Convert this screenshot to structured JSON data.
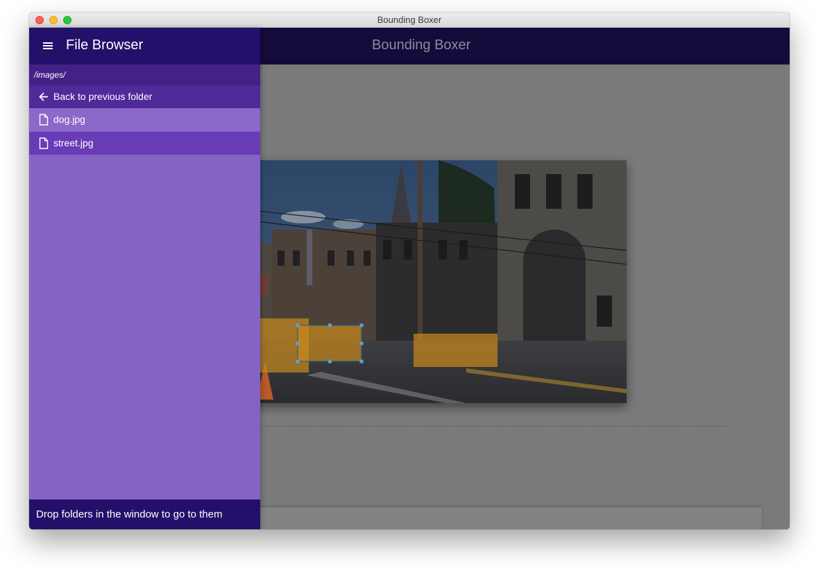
{
  "window": {
    "title": "Bounding Boxer"
  },
  "app_bar": {
    "title": "Bounding Boxer"
  },
  "drawer": {
    "title": "File Browser",
    "menu_icon": "hamburger-menu-icon",
    "current_path": "/images/",
    "back_item": {
      "label": "Back to previous folder",
      "icon": "arrow-left-icon"
    },
    "files": [
      {
        "label": "dog.jpg",
        "icon": "file-icon"
      },
      {
        "label": "street.jpg",
        "icon": "file-icon"
      }
    ],
    "footer_text": "Drop folders in the window to go to them"
  },
  "colors": {
    "drawer_bg": "#8463c5",
    "drawer_header": "#24106a",
    "path_bar": "#432187",
    "back_item": "#4f2a99",
    "file_item": "#8b68c9",
    "file_item_selected": "#6a3bb7",
    "app_bar": "#140b3a",
    "overlay": "#7a7a7a",
    "box_fill": "#c98a1c",
    "box_handle": "#5aa0d8"
  }
}
